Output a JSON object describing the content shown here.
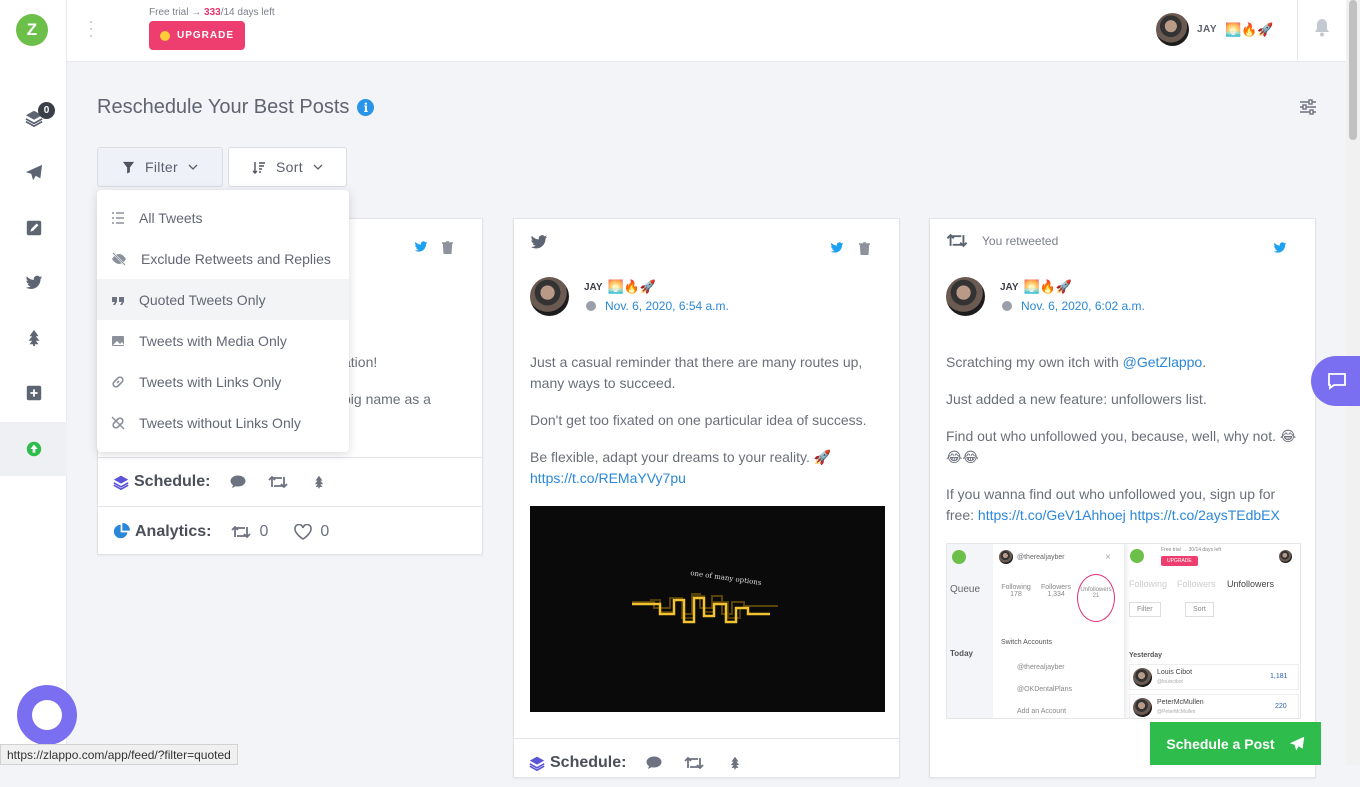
{
  "app": {
    "logo_text": "Z"
  },
  "sidebar": {
    "queue_badge": "0"
  },
  "topbar": {
    "trial_prefix": "Free trial",
    "trial_arrow": "→",
    "trial_used": "333",
    "trial_suffix": "/14 days left",
    "upgrade_label": "UPGRADE",
    "user_name": "JAY",
    "user_emojis": "🌅🔥🚀"
  },
  "page": {
    "title": "Reschedule Your Best Posts",
    "info_glyph": "i",
    "filter_label": "Filter",
    "sort_label": "Sort"
  },
  "filter_menu": [
    {
      "label": "All Tweets"
    },
    {
      "label": "Exclude Retweets and Replies"
    },
    {
      "label": "Quoted Tweets Only"
    },
    {
      "label": "Tweets with Media Only"
    },
    {
      "label": "Tweets with Links Only"
    },
    {
      "label": "Tweets without Links Only"
    }
  ],
  "card1": {
    "partial_line1": "ation!",
    "partial_line2": "big name as a",
    "schedule_label": "Schedule:",
    "analytics_label": "Analytics:",
    "retweets": "0",
    "likes": "0"
  },
  "card2": {
    "author": "JAY",
    "author_emojis": "🌅🔥🚀",
    "date": "Nov. 6, 2020, 6:54 a.m.",
    "p1": "Just a casual reminder that there are many routes up, many ways to succeed.",
    "p2": "Don't get too fixated on one particular idea of success.",
    "p3": "Be flexible, adapt your dreams to your reality. 🚀",
    "link": "https://t.co/REMaYVy7pu",
    "media_caption": "one of many options",
    "schedule_label": "Schedule:"
  },
  "card3": {
    "retweeted_label": "You retweeted",
    "author": "JAY",
    "author_emojis": "🌅🔥🚀",
    "date": "Nov. 6, 2020, 6:02 a.m.",
    "p1_prefix": "Scratching my own itch with ",
    "p1_mention": "@GetZlappo",
    "p1_suffix": ".",
    "p2": "Just added a new feature: unfollowers list.",
    "p3": "Find out who unfollowed you, because, well, why not. 😂😂😂",
    "p4_prefix": "If you wanna find out who unfollowed you, sign up for free: ",
    "p4_link1": "https://t.co/GeV1Ahhoej",
    "p4_link2": "https://t.co/2aysTEdbEX",
    "shot": {
      "handle": "@therealjayber",
      "following_label": "Following",
      "following_val": "178",
      "followers_label": "Followers",
      "followers_val": "1,334",
      "unfollowers_label": "Unfollowers",
      "unfollowers_val": "21",
      "switch_accounts": "Switch Accounts",
      "acct1": "@therealjayber",
      "acct2": "@OKDentalPlans",
      "add_account": "Add an Account",
      "queue": "Queue",
      "today": "Today",
      "trial": "Free trial → 30/14 days left",
      "upgrade": "UPGRADE",
      "tab1": "Following",
      "tab2": "Followers",
      "tab3": "Unfollowers",
      "filter": "Filter",
      "sort": "Sort",
      "yesterday": "Yesterday",
      "person1": "Louis Cibot",
      "person1_handle": "@louiscibot",
      "person1_count": "1,181",
      "person2": "PeterMcMullen",
      "person2_handle": "@PeterMcMullen",
      "person2_count": "220"
    }
  },
  "schedule_post_label": "Schedule a Post",
  "status_url": "https://zlappo.com/app/feed/?filter=quoted"
}
